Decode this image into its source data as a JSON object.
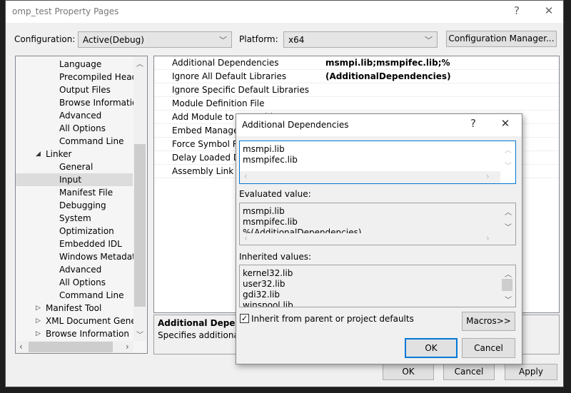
{
  "window": {
    "title": "omp_test Property Pages",
    "help": "?",
    "close": "✕"
  },
  "toolbar": {
    "configuration_label": "Configuration:",
    "configuration_value": "Active(Debug)",
    "platform_label": "Platform:",
    "platform_value": "x64",
    "config_manager": "Configuration Manager..."
  },
  "tree": {
    "items": [
      {
        "label": "Language",
        "level": 2
      },
      {
        "label": "Precompiled Heade",
        "level": 2
      },
      {
        "label": "Output Files",
        "level": 2
      },
      {
        "label": "Browse Information",
        "level": 2
      },
      {
        "label": "Advanced",
        "level": 2
      },
      {
        "label": "All Options",
        "level": 2
      },
      {
        "label": "Command Line",
        "level": 2
      },
      {
        "label": "Linker",
        "level": 1,
        "expanded": true
      },
      {
        "label": "General",
        "level": 2
      },
      {
        "label": "Input",
        "level": 2,
        "selected": true
      },
      {
        "label": "Manifest File",
        "level": 2
      },
      {
        "label": "Debugging",
        "level": 2
      },
      {
        "label": "System",
        "level": 2
      },
      {
        "label": "Optimization",
        "level": 2
      },
      {
        "label": "Embedded IDL",
        "level": 2
      },
      {
        "label": "Windows Metadata",
        "level": 2
      },
      {
        "label": "Advanced",
        "level": 2
      },
      {
        "label": "All Options",
        "level": 2
      },
      {
        "label": "Command Line",
        "level": 2
      },
      {
        "label": "Manifest Tool",
        "level": 1,
        "expanded": false
      },
      {
        "label": "XML Document Genera",
        "level": 1,
        "expanded": false
      },
      {
        "label": "Browse Information",
        "level": 1,
        "expanded": false
      }
    ]
  },
  "grid": {
    "rows": [
      {
        "name": "Additional Dependencies",
        "value": "msmpi.lib;msmpifec.lib;%(AdditionalDependencies)"
      },
      {
        "name": "Ignore All Default Libraries",
        "value": ""
      },
      {
        "name": "Ignore Specific Default Libraries",
        "value": ""
      },
      {
        "name": "Module Definition File",
        "value": ""
      },
      {
        "name": "Add Module to Assembly",
        "value": ""
      },
      {
        "name": "Embed Managed Resource File",
        "value": ""
      },
      {
        "name": "Force Symbol References",
        "value": ""
      },
      {
        "name": "Delay Loaded Dlls",
        "value": ""
      },
      {
        "name": "Assembly Link Resource",
        "value": ""
      }
    ]
  },
  "description": {
    "title": "Additional Dependencies",
    "text": "Specifies additional items to add to the link command line."
  },
  "footer": {
    "ok": "OK",
    "cancel": "Cancel",
    "apply": "Apply"
  },
  "dialog": {
    "title": "Additional Dependencies",
    "help": "?",
    "close": "✕",
    "edit_lines": [
      "msmpi.lib",
      "msmpifec.lib"
    ],
    "evaluated_label": "Evaluated value:",
    "evaluated_lines": [
      "msmpi.lib",
      "msmpifec.lib",
      "%(AdditionalDependencies)"
    ],
    "inherited_label": "Inherited values:",
    "inherited_lines": [
      "kernel32.lib",
      "user32.lib",
      "gdi32.lib",
      "winspool.lib"
    ],
    "inherit_checkbox": "Inherit from parent or project defaults",
    "inherit_checked": true,
    "macros": "Macros>>",
    "ok": "OK",
    "cancel": "Cancel"
  }
}
